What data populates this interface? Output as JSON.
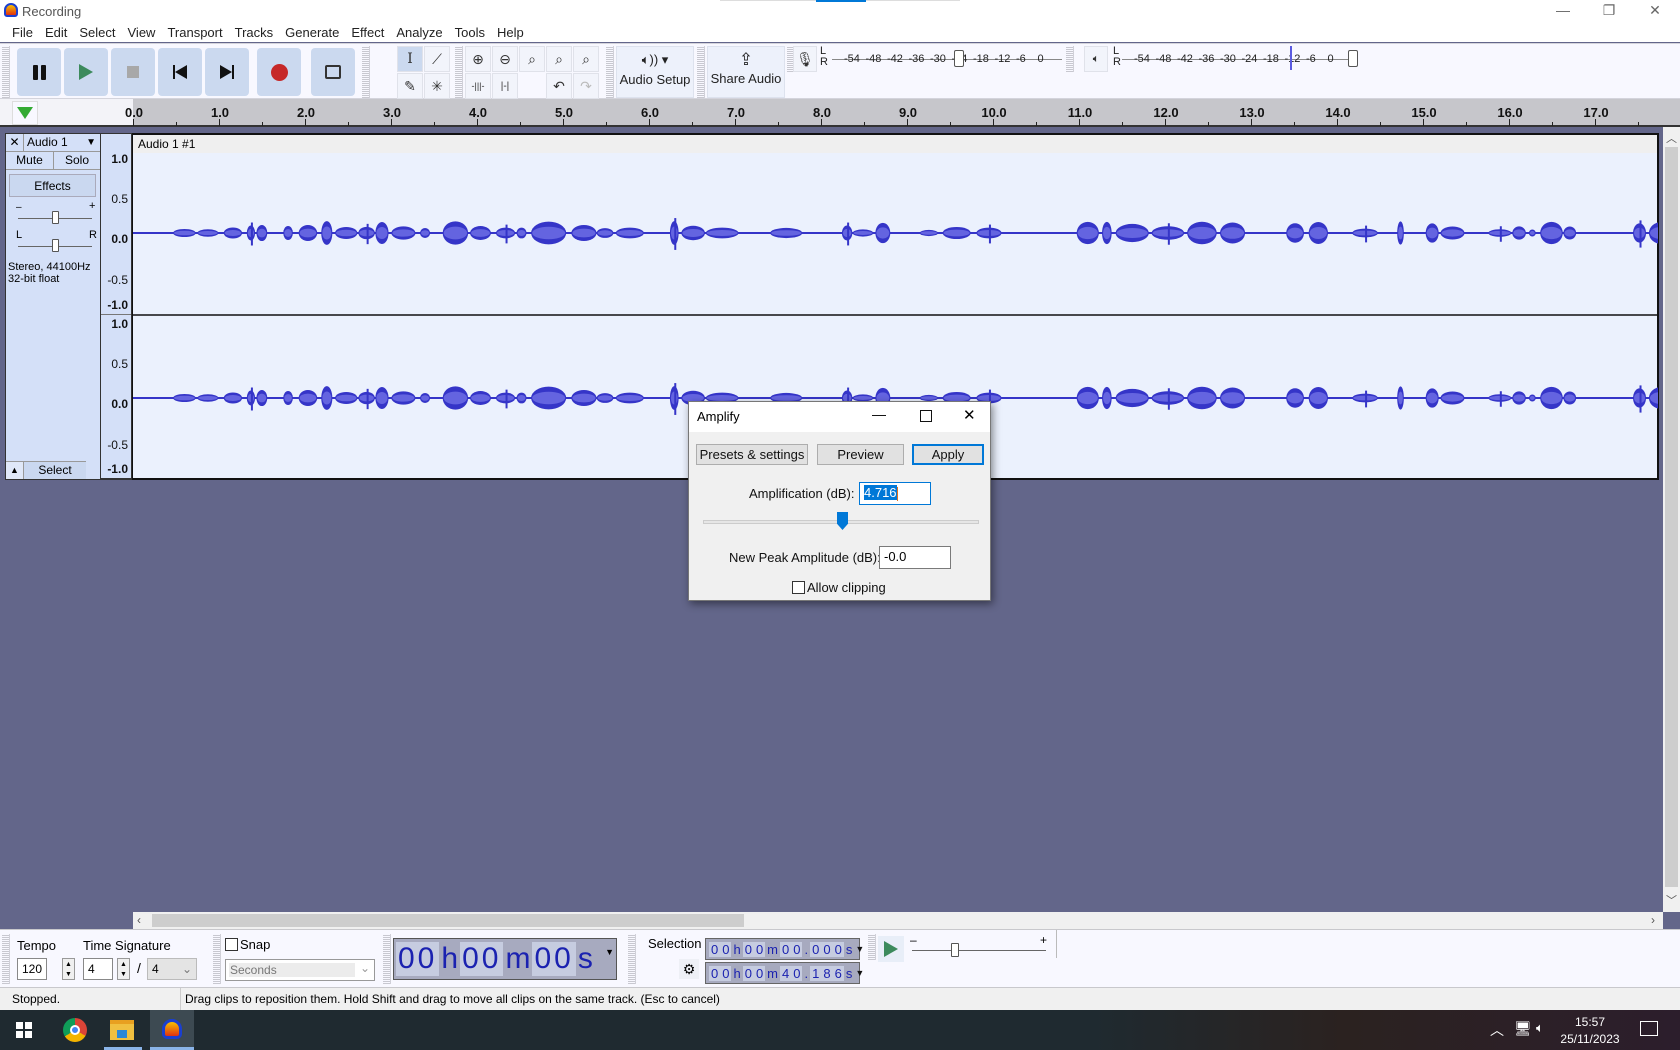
{
  "window": {
    "title": "Recording",
    "controls": {
      "minimize": "—",
      "restore": "❐",
      "close": "✕"
    }
  },
  "menu": [
    "File",
    "Edit",
    "Select",
    "View",
    "Transport",
    "Tracks",
    "Generate",
    "Effect",
    "Analyze",
    "Tools",
    "Help"
  ],
  "transport": {
    "buttons": [
      "pause-icon",
      "play-icon",
      "stop-icon",
      "skip-to-start-icon",
      "skip-to-end-icon",
      "record-icon",
      "loop-icon"
    ],
    "colors": {
      "play": "#3c8a5c",
      "record": "#c62828",
      "stop": "#a8a8a8"
    }
  },
  "tools": {
    "selection": "I",
    "envelope": "⟋",
    "draw": "✎",
    "multi": "✳",
    "zoom_in": "⊕",
    "zoom_out": "⊖",
    "fit_selection": "⌕",
    "fit_project": "⌕",
    "zoom_toggle": "⌕",
    "trim_outside": "-|||-",
    "silence": "|-|",
    "undo": "↶",
    "redo": "↷"
  },
  "audio_setup": {
    "label": "Audio Setup",
    "icon": "🔈︎)) ▾"
  },
  "share_audio": {
    "label": "Share Audio",
    "icon": "⇪"
  },
  "meters": {
    "record_scale": [
      "-54",
      "-48",
      "-42",
      "-36",
      "-30",
      "-24",
      "-18",
      "-12",
      "-6",
      "0"
    ],
    "play_scale": [
      "-54",
      "-48",
      "-42",
      "-36",
      "-30",
      "-24",
      "-18",
      "-12",
      "-6",
      "0"
    ],
    "channels": [
      "L",
      "R"
    ]
  },
  "ruler": {
    "labels": [
      "0.0",
      "1.0",
      "2.0",
      "3.0",
      "4.0",
      "5.0",
      "6.0",
      "7.0",
      "8.0",
      "9.0",
      "10.0",
      "11.0",
      "12.0",
      "13.0",
      "14.0",
      "15.0",
      "16.0",
      "17.0"
    ]
  },
  "track": {
    "name": "Audio 1",
    "close": "✕",
    "menu_arrow": "▼",
    "mute": "Mute",
    "solo": "Solo",
    "effects": "Effects",
    "gain_minus": "–",
    "gain_plus": "+",
    "pan_left": "L",
    "pan_right": "R",
    "info_line1": "Stereo, 44100Hz",
    "info_line2": "32-bit float",
    "collapse": "▲",
    "select": "Select",
    "clip_name": "Audio 1 #1",
    "vruler_labels": [
      "1.0",
      "0.5",
      "0.0",
      "-0.5",
      "-1.0"
    ],
    "waveform_color": "#3535c8",
    "waveform_rms_color": "#6464e0"
  },
  "amplify_dialog": {
    "title": "Amplify",
    "presets_label": "Presets & settings",
    "preview_label": "Preview",
    "apply_label": "Apply",
    "amplification_label": "Amplification (dB):",
    "amplification_value": "4.716",
    "slider_fraction": 0.5,
    "new_peak_label": "New Peak Amplitude (dB):",
    "new_peak_value": "-0.0",
    "allow_clipping_label": "Allow clipping",
    "allow_clipping_checked": false
  },
  "bottom": {
    "tempo_label": "Tempo",
    "tempo_value": "120",
    "time_sig_label": "Time Signature",
    "time_sig_num": "4",
    "time_sig_sep": "/",
    "time_sig_den": "4",
    "snap_label": "Snap",
    "snap_checked": false,
    "snap_unit": "Seconds",
    "time_display": [
      "00",
      "h",
      "00",
      "m",
      "00",
      "s"
    ],
    "selection_label": "Selection",
    "selection_start": [
      "0",
      "0",
      "h",
      "0",
      "0",
      "m",
      "0",
      "0",
      ".",
      "0",
      "0",
      "0",
      "s"
    ],
    "selection_end": [
      "0",
      "0",
      "h",
      "0",
      "0",
      "m",
      "4",
      "0",
      ".",
      "1",
      "8",
      "6",
      "s"
    ],
    "play_speed_minus": "–",
    "play_speed_plus": "+"
  },
  "status": {
    "state": "Stopped.",
    "hint": "Drag clips to reposition them. Hold Shift and drag to move all clips on the same track. (Esc to cancel)"
  },
  "taskbar": {
    "apps": [
      "windows-start",
      "chrome",
      "file-explorer",
      "audacity"
    ],
    "time": "15:57",
    "date": "25/11/2023"
  }
}
